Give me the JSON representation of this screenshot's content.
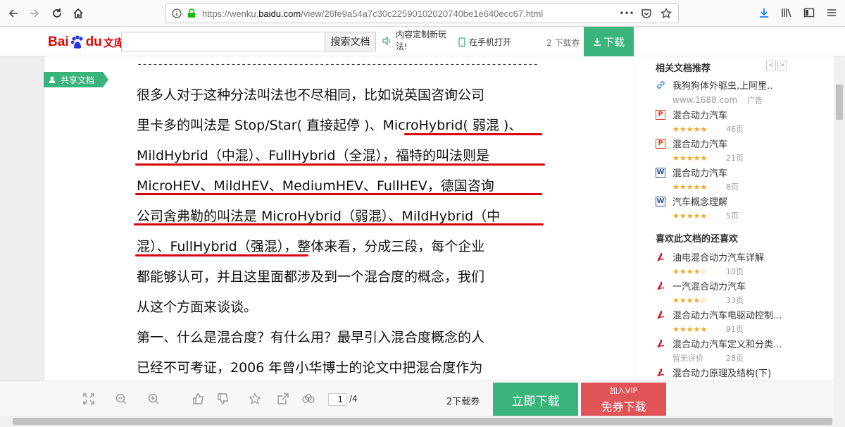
{
  "browser": {
    "url_prefix": "https://wenku.",
    "url_domain": "baidu.com",
    "url_suffix": "/view/26fe9a54a7c30c22590102020740be1e640ecc67.html",
    "more_label": "•••"
  },
  "header": {
    "logo_bai": "Bai",
    "logo_du": "du",
    "logo_wenku": "文库",
    "search_placeholder": "",
    "search_button": "搜索文档",
    "promo_text": "内容定制新玩法!",
    "mobile_text": "在手机打开",
    "coupon_text": "2 下载券",
    "download_button": "下载"
  },
  "document": {
    "share_tag": "共享文档",
    "dashes": "-----------------------------------------------------------------------------",
    "lines": [
      "很多人对于这种分法叫法也不尽相同，比如说英国咨询公司",
      "里卡多的叫法是 Stop/Star( 直接起停 )、MicroHybrid( 弱混 )、",
      "MildHybrid（中混）、FullHybrid（全混），福特的叫法则是",
      "MicroHEV、MildHEV、MediumHEV、FullHEV，德国咨询",
      "公司舍弗勒的叫法是 MicroHybrid（弱混）、MildHybrid（中",
      "混）、FullHybrid（强混），整体来看，分成三段，每个企业",
      "都能够认可，并且这里面都涉及到一个混合度的概念，我们",
      "从这个方面来谈谈。",
      "第一、什么是混合度？有什么用？最早引入混合度概念的人",
      "已经不可考证，2006 年曾小华博士的论文中把混合度作为"
    ]
  },
  "sidebar": {
    "related_title": "相关文档推荐",
    "prev_arrow": "<",
    "next_arrow": ">",
    "related": [
      {
        "title": "我狗狗体外驱虫,上阿里..",
        "stars": "",
        "pages": "",
        "icon": "link",
        "ad_source": "www.1688.com",
        "ad_label": "广告"
      },
      {
        "title": "混合动力汽车",
        "stars": "★★★★★",
        "pages": "46页",
        "icon": "ppt"
      },
      {
        "title": "混合动力汽车",
        "stars": "★★★★★",
        "pages": "21页",
        "icon": "ppt"
      },
      {
        "title": "混合动力汽车",
        "stars": "★★★★★",
        "pages": "8页",
        "icon": "word"
      },
      {
        "title": "汽车概念理解",
        "stars": "★★★★★",
        "pages": "5页",
        "icon": "word"
      }
    ],
    "also_title": "喜欢此文档的还喜欢",
    "also": [
      {
        "title": "油电混合动力汽车详解",
        "stars": "★★★★☆",
        "pages": "10页"
      },
      {
        "title": "一汽混合动力汽车",
        "stars": "★★★★☆",
        "pages": "33页"
      },
      {
        "title": "混合动力汽车电驱动控制...",
        "stars": "★★★★★",
        "pages": "91页"
      },
      {
        "title": "混合动力汽车定义和分类...",
        "stars": "暂无评价",
        "pages": "28页"
      },
      {
        "title": "混合动力原理及结构(下)",
        "stars": "",
        "pages": ""
      }
    ]
  },
  "bottom": {
    "page_current": "1",
    "page_total": "/4",
    "coupon_text": "2下载券",
    "download_now": "立即下载",
    "vip_small": "加入VIP",
    "vip_big": "免券下载"
  },
  "colors": {
    "green": "#3ab37c",
    "red": "#e05356",
    "baidu_red": "#e10601",
    "underline": "#d9000d"
  }
}
